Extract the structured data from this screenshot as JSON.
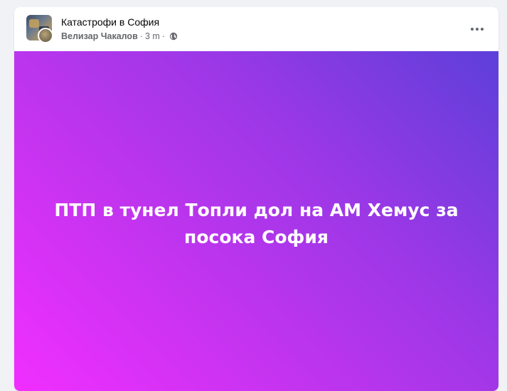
{
  "post": {
    "group_name": "Катастрофи в София",
    "author": "Велизар Чакалов",
    "separator": "·",
    "time": "3 m",
    "privacy_icon": "globe-icon",
    "more_icon": "more-options-icon",
    "text": "ПТП в тунел Топли дол на АМ Хемус за посока София",
    "background_gradient": [
      "#5d3fd9",
      "#9a38e6",
      "#c334ef",
      "#f12eff"
    ]
  }
}
